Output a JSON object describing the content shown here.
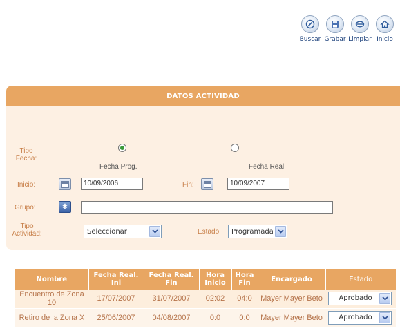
{
  "toolbar": {
    "buscar": {
      "label": "Buscar",
      "icon": "search-icon"
    },
    "grabar": {
      "label": "Grabar",
      "icon": "save-icon"
    },
    "limpiar": {
      "label": "Limpiar",
      "icon": "clear-icon"
    },
    "inicio": {
      "label": "Inicio",
      "icon": "home-icon"
    }
  },
  "form": {
    "title": "DATOS ACTIVIDAD",
    "tipo_fecha_label": "Tipo\nFecha:",
    "fecha_prog_label": "Fecha Prog.",
    "fecha_real_label": "Fecha Real",
    "fecha_prog_checked": true,
    "inicio_label": "Inicio:",
    "inicio_value": "10/09/2006",
    "fin_label": "Fin:",
    "fin_value": "10/09/2007",
    "grupo_label": "Grupo:",
    "grupo_value": "",
    "tipo_actividad_label": "Tipo\nActividad:",
    "tipo_actividad_value": "Seleccionar",
    "estado_label": "Estado:",
    "estado_value": "Programada"
  },
  "table": {
    "headers": [
      "Nombre",
      "Fecha Real. Ini",
      "Fecha Real. Fin",
      "Hora Inicio",
      "Hora Fin",
      "Encargado",
      "Estado"
    ],
    "rows": [
      [
        "Encuentro de Zona 10",
        "17/07/2007",
        "31/07/2007",
        "02:02",
        "04:0",
        "Mayer Mayer Beto",
        "Aprobado"
      ],
      [
        "Retiro de la Zona X",
        "25/06/2007",
        "04/08/2007",
        "0:0",
        "0:0",
        "Mayer Mayer Beto",
        "Aprobado"
      ]
    ]
  },
  "colors": {
    "accent": "#e8a662",
    "panel_bg": "#fdf0e3",
    "label": "#c8804a",
    "link": "#1a3f7a"
  }
}
